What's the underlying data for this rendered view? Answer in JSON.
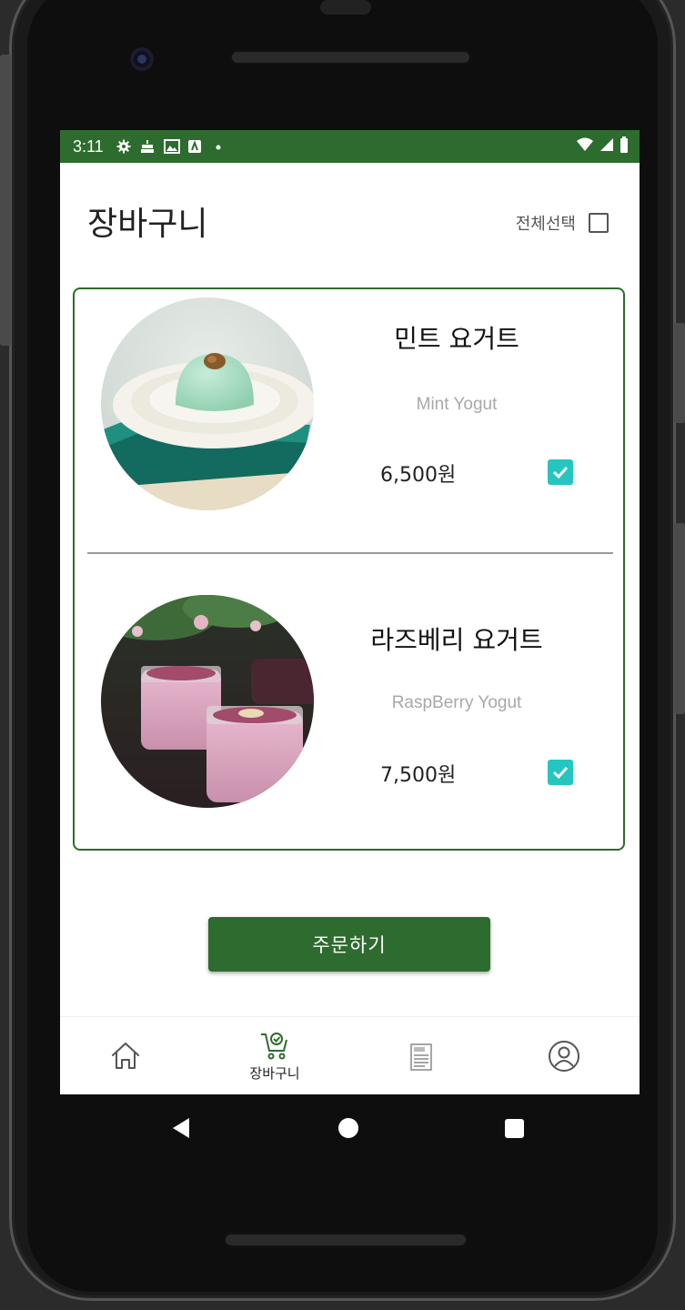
{
  "status_bar": {
    "time": "3:11"
  },
  "header": {
    "title": "장바구니",
    "select_all_label": "전체선택"
  },
  "items": [
    {
      "name": "민트 요거트",
      "english_name": "Mint Yogut",
      "price": "6,500원",
      "checked": true,
      "image": "mint-yogurt-dessert-photo"
    },
    {
      "name": "라즈베리 요거트",
      "english_name": "RaspBerry Yogut",
      "price": "7,500원",
      "checked": true,
      "image": "raspberry-yogurt-jars-photo"
    }
  ],
  "order_button": {
    "label": "주문하기"
  },
  "bottom_nav": {
    "items": [
      {
        "icon": "home-icon",
        "label": ""
      },
      {
        "icon": "cart-icon",
        "label": "장바구니"
      },
      {
        "icon": "menu-icon",
        "label": ""
      },
      {
        "icon": "profile-icon",
        "label": ""
      }
    ]
  },
  "colors": {
    "primary": "#2e6b2e",
    "checkbox": "#26c6c0",
    "subtitle": "#a8a8a8"
  }
}
